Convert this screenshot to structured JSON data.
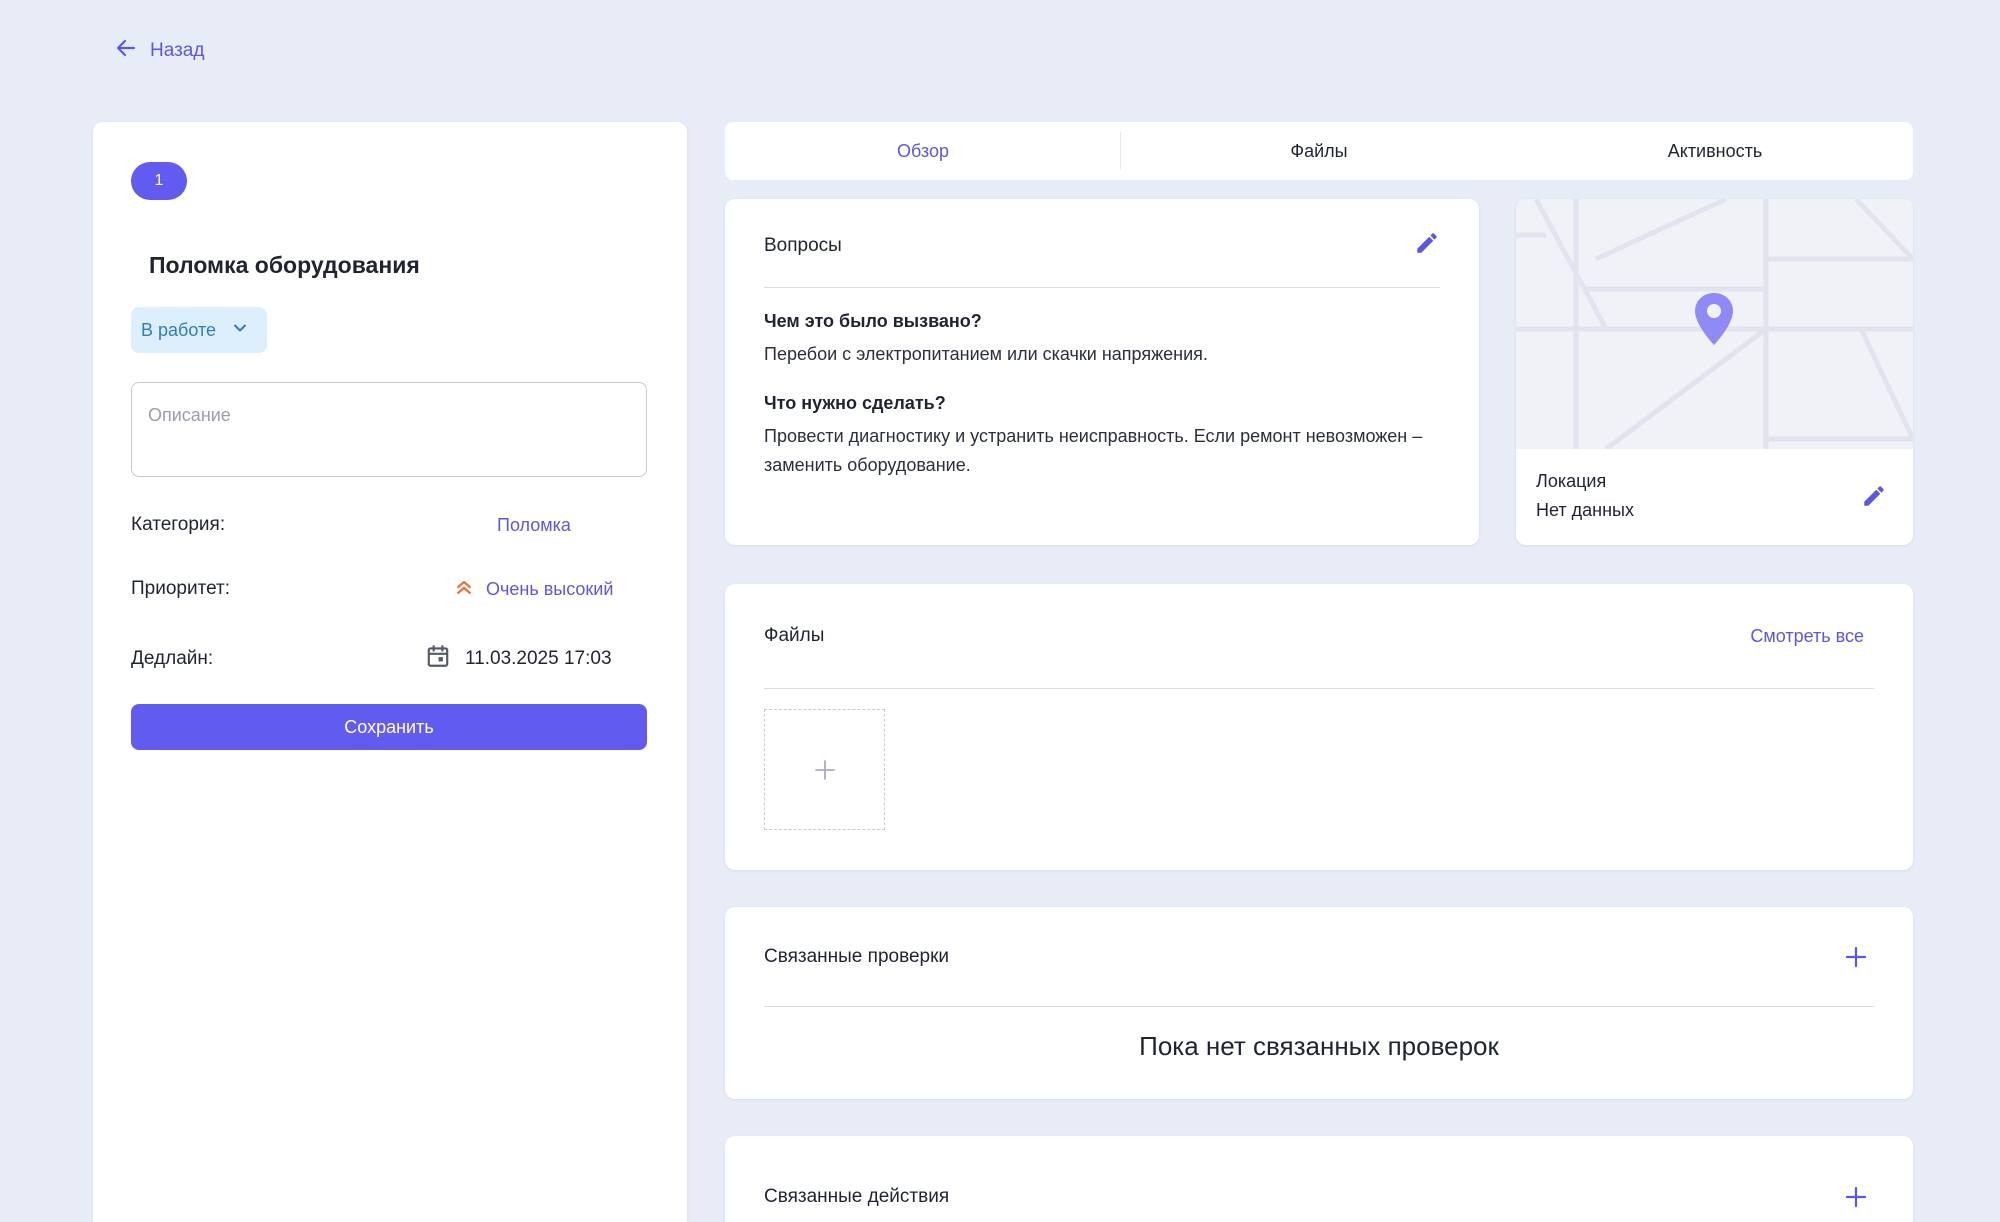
{
  "nav": {
    "back_label": "Назад"
  },
  "incident": {
    "id_badge": "1",
    "title": "Поломка оборудования",
    "status": "В работе",
    "description_placeholder": "Описание",
    "category_label": "Категория:",
    "category_value": "Поломка",
    "priority_label": "Приоритет:",
    "priority_value": "Очень высокий",
    "deadline_label": "Дедлайн:",
    "deadline_value": "11.03.2025 17:03",
    "save_label": "Сохранить"
  },
  "tabs": [
    {
      "label": "Обзор",
      "active": true
    },
    {
      "label": "Файлы",
      "active": false
    },
    {
      "label": "Активность",
      "active": false
    }
  ],
  "questions": {
    "title": "Вопросы",
    "items": [
      {
        "question": "Чем это было вызвано?",
        "answer": "Перебои с электропитанием или скачки напряжения."
      },
      {
        "question": "Что нужно сделать?",
        "answer": "Провести диагностику и устранить неисправность. Если ремонт невозможен – заменить оборудование."
      }
    ]
  },
  "location": {
    "label": "Локация",
    "value": "Нет данных"
  },
  "files": {
    "title": "Файлы",
    "see_all": "Смотреть все"
  },
  "linked_checks": {
    "title": "Связанные проверки",
    "empty": "Пока нет связанных проверок"
  },
  "linked_actions": {
    "title": "Связанные действия"
  },
  "colors": {
    "accent": "#625BF0",
    "link": "#5E56E0",
    "status_bg": "#DDEFFC",
    "status_text": "#2E7CC7",
    "priority_icon": "#F0703A",
    "page_bg": "#E8ECF6"
  },
  "icons": {
    "back": "arrow-left-icon",
    "status_dropdown": "chevron-down-icon",
    "priority": "double-chevron-up-icon",
    "deadline": "calendar-icon",
    "edit": "pencil-icon",
    "map_pin": "map-pin-icon",
    "add": "plus-icon"
  }
}
